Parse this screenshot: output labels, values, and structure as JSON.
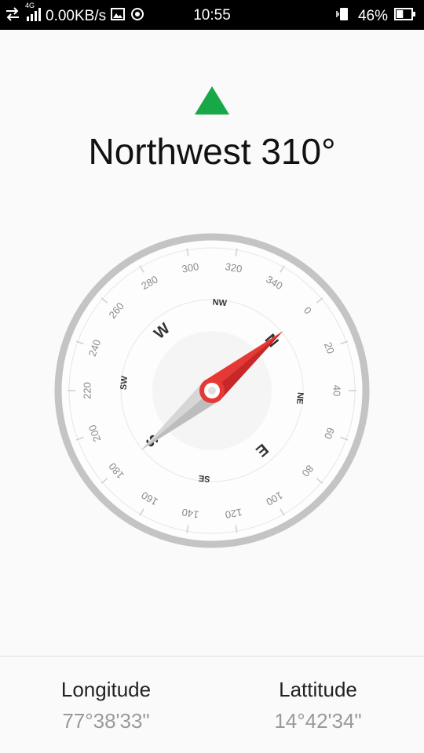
{
  "status_bar": {
    "network_type": "4G",
    "speed": "0.00KB/s",
    "time": "10:55",
    "battery_percent": "46%",
    "battery_level": 0.46,
    "icons": [
      "data-arrows-icon",
      "signal-icon",
      "image-icon",
      "location-icon",
      "vibrate-icon",
      "battery-icon"
    ]
  },
  "compass": {
    "direction_label": "Northwest",
    "degrees_label": "310°",
    "heading_degrees": 310,
    "indicator_color": "#18a848",
    "needle_north_color": "#e53935",
    "cardinals": [
      "N",
      "E",
      "S",
      "W"
    ],
    "intercardinals": [
      "NE",
      "SE",
      "SW",
      "NW"
    ],
    "degree_labels": [
      "0",
      "20",
      "40",
      "60",
      "80",
      "100",
      "120",
      "140",
      "160",
      "180",
      "200",
      "220",
      "240",
      "260",
      "280",
      "300",
      "320",
      "340"
    ]
  },
  "location": {
    "longitude_label": "Longitude",
    "longitude_value": "77°38'33\"",
    "latitude_label": "Lattitude",
    "latitude_value": "14°42'34\""
  }
}
